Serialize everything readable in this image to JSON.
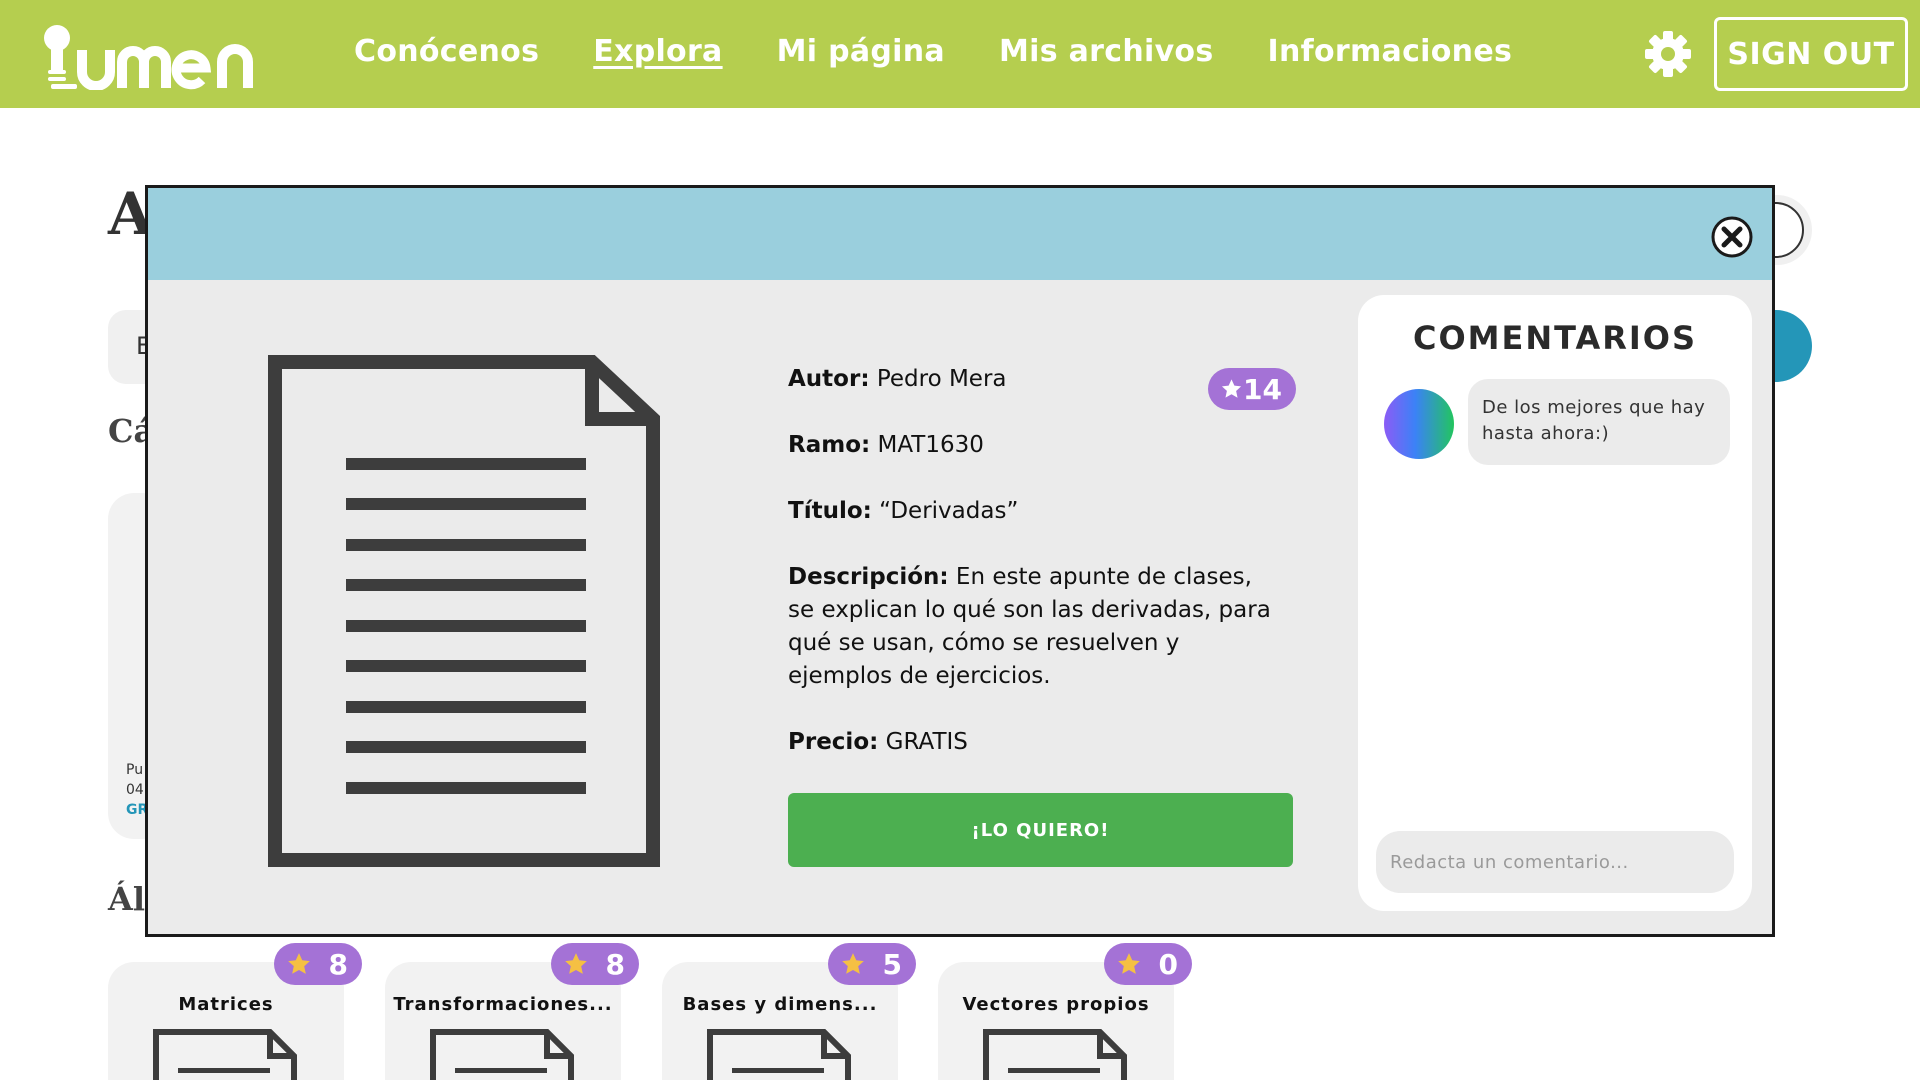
{
  "header": {
    "logo_text": "lumen",
    "nav": [
      {
        "label": "Conócenos",
        "active": false
      },
      {
        "label": "Explora",
        "active": true
      },
      {
        "label": "Mi página",
        "active": false
      },
      {
        "label": "Mis archivos",
        "active": false
      },
      {
        "label": "Informaciones",
        "active": false
      }
    ],
    "settings_icon": "gear-icon",
    "signout_label": "SIGN OUT"
  },
  "background": {
    "title_fragment": "A",
    "filter_fragment": "E",
    "section1_fragment": "Cá",
    "section2_fragment": "Ál",
    "card_fragment": {
      "line1": "Pu",
      "line2": "04.",
      "line3": "GR"
    },
    "cards": [
      {
        "title": "Matrices",
        "rating": "8"
      },
      {
        "title": "Transformaciones...",
        "rating": "8"
      },
      {
        "title": "Bases y dimens...",
        "rating": "5"
      },
      {
        "title": "Vectores propios",
        "rating": "0"
      }
    ]
  },
  "modal": {
    "close_icon": "close-icon",
    "document_icon": "document-icon",
    "rating": "14",
    "author_label": "Autor:",
    "author": "Pedro Mera",
    "course_label": "Ramo:",
    "course": "MAT1630",
    "title_label": "Título:",
    "title": "“Derivadas”",
    "description_label": "Descripción:",
    "description": "En este apunte de clases, se explican lo qué son las derivadas, para qué se usan, cómo se resuelven y ejemplos de ejercicios.",
    "price_label": "Precio:",
    "price": "GRATIS",
    "cta_label": "¡LO QUIERO!",
    "comments": {
      "title": "COMENTARIOS",
      "items": [
        {
          "text": "De los mejores que hay hasta ahora:)"
        }
      ],
      "input_placeholder": "Redacta un comentario..."
    }
  },
  "colors": {
    "topbar": "#b5ce4f",
    "modal_header": "#9acfdd",
    "badge": "#a472d6",
    "cta": "#4caf50",
    "accent_blue": "#2496b8"
  }
}
